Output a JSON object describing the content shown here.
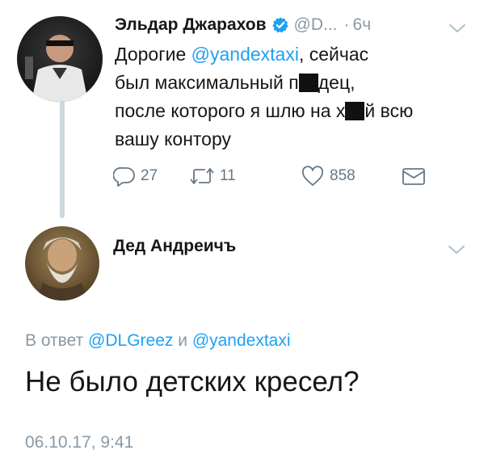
{
  "tweet": {
    "author_name": "Эльдар Джарахов",
    "handle": "@D...",
    "dot": "·",
    "time": "6ч",
    "text": {
      "greeting": "Дорогие ",
      "mention": "@yandextaxi",
      "line1_rest": ", сейчас",
      "line2_start": "был максимальный п",
      "line2_end": "дец,",
      "line3_start": "после которого я шлю на х",
      "line3_end": "й всю",
      "line4": "вашу контору"
    },
    "actions": {
      "replies": "27",
      "retweets": "11",
      "likes": "858"
    }
  },
  "reply": {
    "author_name": "Дед Андреичъ",
    "reply_prefix": "В ответ ",
    "mention_1": "@DLGreez",
    "conjunction": " и ",
    "mention_2": "@yandextaxi",
    "text": "Не было детских кресел?",
    "timestamp": "06.10.17, 9:41"
  },
  "colors": {
    "link": "#1da1f2",
    "secondary": "#8899a6",
    "text": "#14171a",
    "thread_line": "#ccd6dd"
  },
  "icons": [
    "verified-badge-icon",
    "chevron-down-icon",
    "reply-icon",
    "retweet-icon",
    "like-icon",
    "direct-message-icon"
  ]
}
